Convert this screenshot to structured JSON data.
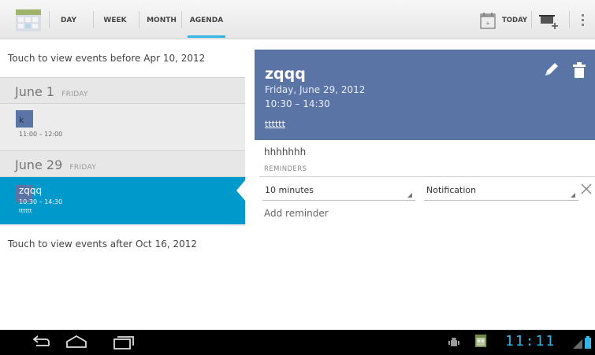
{
  "action_bar": {
    "app_icon": "calendar-app-icon",
    "tabs": [
      {
        "label": "DAY",
        "active": false
      },
      {
        "label": "WEEK",
        "active": false
      },
      {
        "label": "MONTH",
        "active": false
      },
      {
        "label": "AGENDA",
        "active": true
      }
    ],
    "today_label": "TODAY",
    "today_icon": "calendar-today-icon",
    "new_event_icon": "new-event-icon",
    "overflow_icon": "overflow-menu-icon"
  },
  "agenda": {
    "before_text": "Touch to view events before Apr 10, 2012",
    "days": [
      {
        "date": "June 1",
        "weekday": "FRIDAY",
        "events": [
          {
            "title": "k",
            "time": "11:00 – 12:00",
            "description": "",
            "selected": false
          }
        ]
      },
      {
        "date": "June 29",
        "weekday": "FRIDAY",
        "events": [
          {
            "title": "zqqq",
            "time": "10:30 – 14:30",
            "description": "tttttt",
            "selected": true
          }
        ]
      }
    ],
    "after_text": "Touch to view events after Oct 16, 2012"
  },
  "detail": {
    "title": "zqqq",
    "date": "Friday, June 29, 2012",
    "time": "10:30 – 14:30",
    "location": "tttttt",
    "description": "hhhhhhh",
    "reminders_label": "REMINDERS",
    "reminder": {
      "interval": "10 minutes",
      "method": "Notification"
    },
    "add_reminder": "Add reminder",
    "edit_icon": "pencil-icon",
    "delete_icon": "trash-icon",
    "remove_icon": "close-icon"
  },
  "system_bar": {
    "clock": "11:11",
    "buttons": [
      "back-icon",
      "home-icon",
      "recent-apps-icon"
    ]
  },
  "colors": {
    "accent": "#33b5e5",
    "selected_row": "#0099cc",
    "event_color": "#5b74a6"
  }
}
